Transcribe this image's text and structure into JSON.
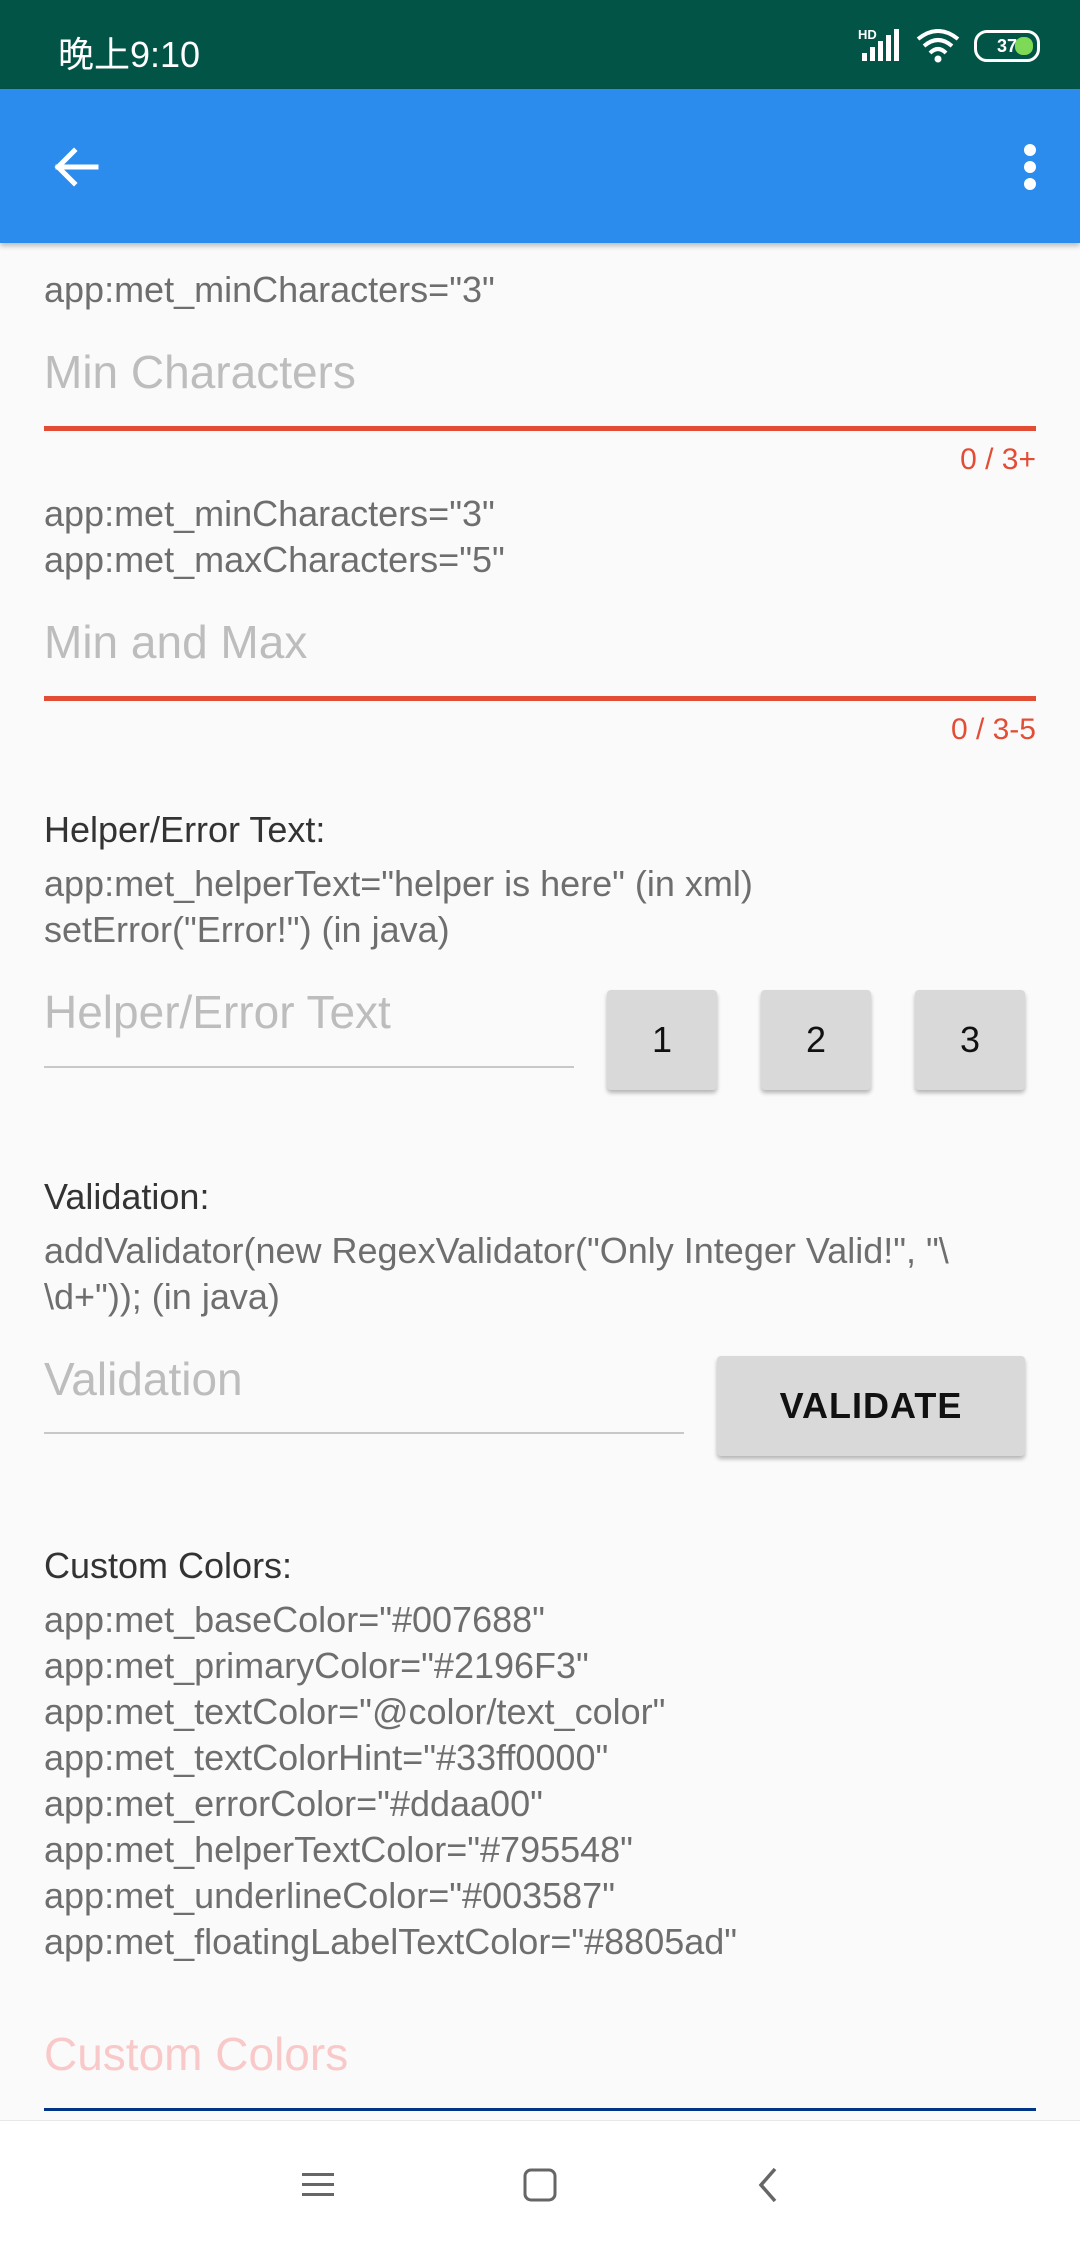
{
  "status_bar": {
    "time": "晚上9:10",
    "hd_label": "HD",
    "battery_level": "37",
    "icons": [
      "signal-icon",
      "wifi-icon",
      "battery-icon"
    ]
  },
  "app_bar": {
    "background": "#2b8ced",
    "icons": [
      "back-arrow-icon",
      "more-vert-icon"
    ]
  },
  "min_characters": {
    "code": "app:met_minCharacters=\"3\"",
    "placeholder": "Min Characters",
    "counter": "0 / 3+"
  },
  "min_max": {
    "code_line_1": "app:met_minCharacters=\"3\"",
    "code_line_2": "app:met_maxCharacters=\"5\"",
    "placeholder": "Min and Max",
    "counter": "0 / 3-5"
  },
  "helper_error": {
    "title": "Helper/Error Text:",
    "code_line_1": "app:met_helperText=\"helper is here\" (in xml)",
    "code_line_2": "setError(\"Error!\") (in java)",
    "placeholder": "Helper/Error Text",
    "buttons": [
      "1",
      "2",
      "3"
    ]
  },
  "validation": {
    "title": "Validation:",
    "code_line_1": "addValidator(new RegexValidator(\"Only Integer Valid!\", \"\\",
    "code_line_2": "\\d+\")); (in java)",
    "placeholder": "Validation",
    "button_label": "VALIDATE"
  },
  "custom_colors": {
    "title": "Custom Colors:",
    "code_lines": [
      "app:met_baseColor=\"#007688\"",
      "app:met_primaryColor=\"#2196F3\"",
      "app:met_textColor=\"@color/text_color\"",
      "app:met_textColorHint=\"#33ff0000\"",
      "app:met_errorColor=\"#ddaa00\"",
      "app:met_helperTextColor=\"#795548\"",
      "app:met_underlineColor=\"#003587\"",
      "app:met_floatingLabelTextColor=\"#8805ad\""
    ],
    "placeholder": "Custom Colors",
    "hint_color": "#f9c9c9",
    "underline_color": "#003587"
  },
  "nav_bar": {
    "icons": [
      "menu-icon",
      "home-square-icon",
      "back-chevron-icon"
    ]
  }
}
